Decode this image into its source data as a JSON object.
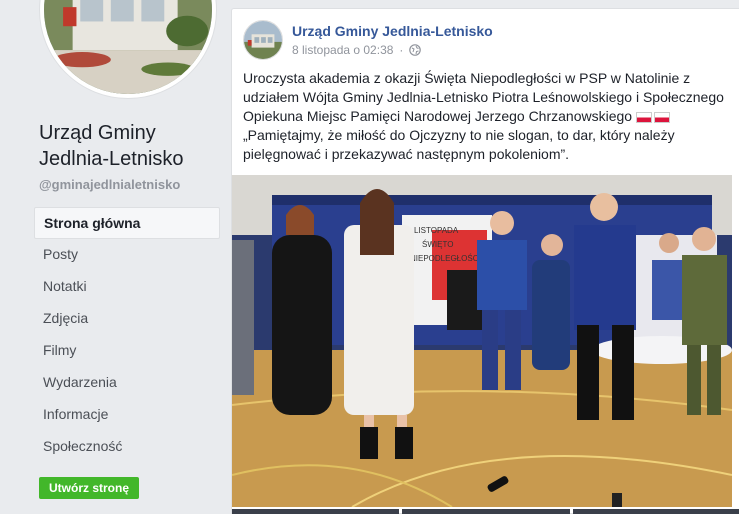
{
  "page": {
    "name": "Urząd Gminy Jedlnia-Letnisko",
    "handle": "@gminajedlnialetnisko"
  },
  "nav": {
    "items": [
      {
        "label": "Strona główna",
        "active": true
      },
      {
        "label": "Posty"
      },
      {
        "label": "Notatki"
      },
      {
        "label": "Zdjęcia"
      },
      {
        "label": "Filmy"
      },
      {
        "label": "Wydarzenia"
      },
      {
        "label": "Informacje"
      },
      {
        "label": "Społeczność"
      }
    ],
    "create_label": "Utwórz stronę"
  },
  "post": {
    "author": "Urząd Gminy Jedlnia-Letnisko",
    "date": "8 listopada o 02:38",
    "separator": "·",
    "text_main": "Uroczysta akademia z okazji Święta Niepodległości w PSP w Natolinie z udziałem Wójta Gminy Jedlnia-Letnisko Piotra Leśnowolskiego i Społecznego Opiekuna Miejsc Pamięci Narodowej Jerzego Chrzanowskiego",
    "text_quote": "„Pamiętajmy, że miłość do Ojczyzny to nie slogan, to dar, który należy pielęgnować i przekazywać następnym pokoleniom”.",
    "banner_text": "LISTOPADA\nŚWIĘTO\nNIEPODLEGŁOŚCI",
    "visibility_icon": "globe-icon",
    "emoji_flags": 2
  },
  "colors": {
    "link": "#365899",
    "create_button": "#42b72a",
    "background": "#e9ebee"
  }
}
